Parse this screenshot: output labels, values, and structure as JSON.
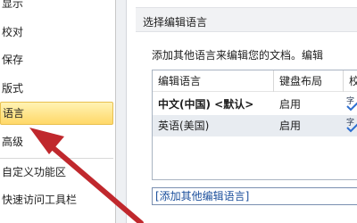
{
  "sidebar": {
    "items": [
      {
        "label": "显示"
      },
      {
        "label": "校对"
      },
      {
        "label": "保存"
      },
      {
        "label": "版式"
      },
      {
        "label": "语言"
      },
      {
        "label": "高级"
      },
      {
        "label": "自定义功能区"
      },
      {
        "label": "快速访问工具栏"
      }
    ],
    "selected": "语言"
  },
  "content": {
    "section_title": "选择编辑语言",
    "description": "添加其他语言来编辑您的文档。编辑",
    "table": {
      "columns": [
        "编辑语言",
        "键盘布局",
        "校"
      ],
      "rows": [
        {
          "language": "中文(中国) <默认>",
          "keyboard": "启用",
          "proofing_icon": "proofing-check-icon"
        },
        {
          "language": "英语(美国)",
          "keyboard": "启用",
          "proofing_icon": "proofing-check-icon"
        }
      ]
    },
    "add_language_placeholder": "[添加其他编辑语言]"
  },
  "colors": {
    "selected_bg": "#ffd868",
    "arrow": "#c0282d",
    "link_blue": "#1b4f9c"
  }
}
